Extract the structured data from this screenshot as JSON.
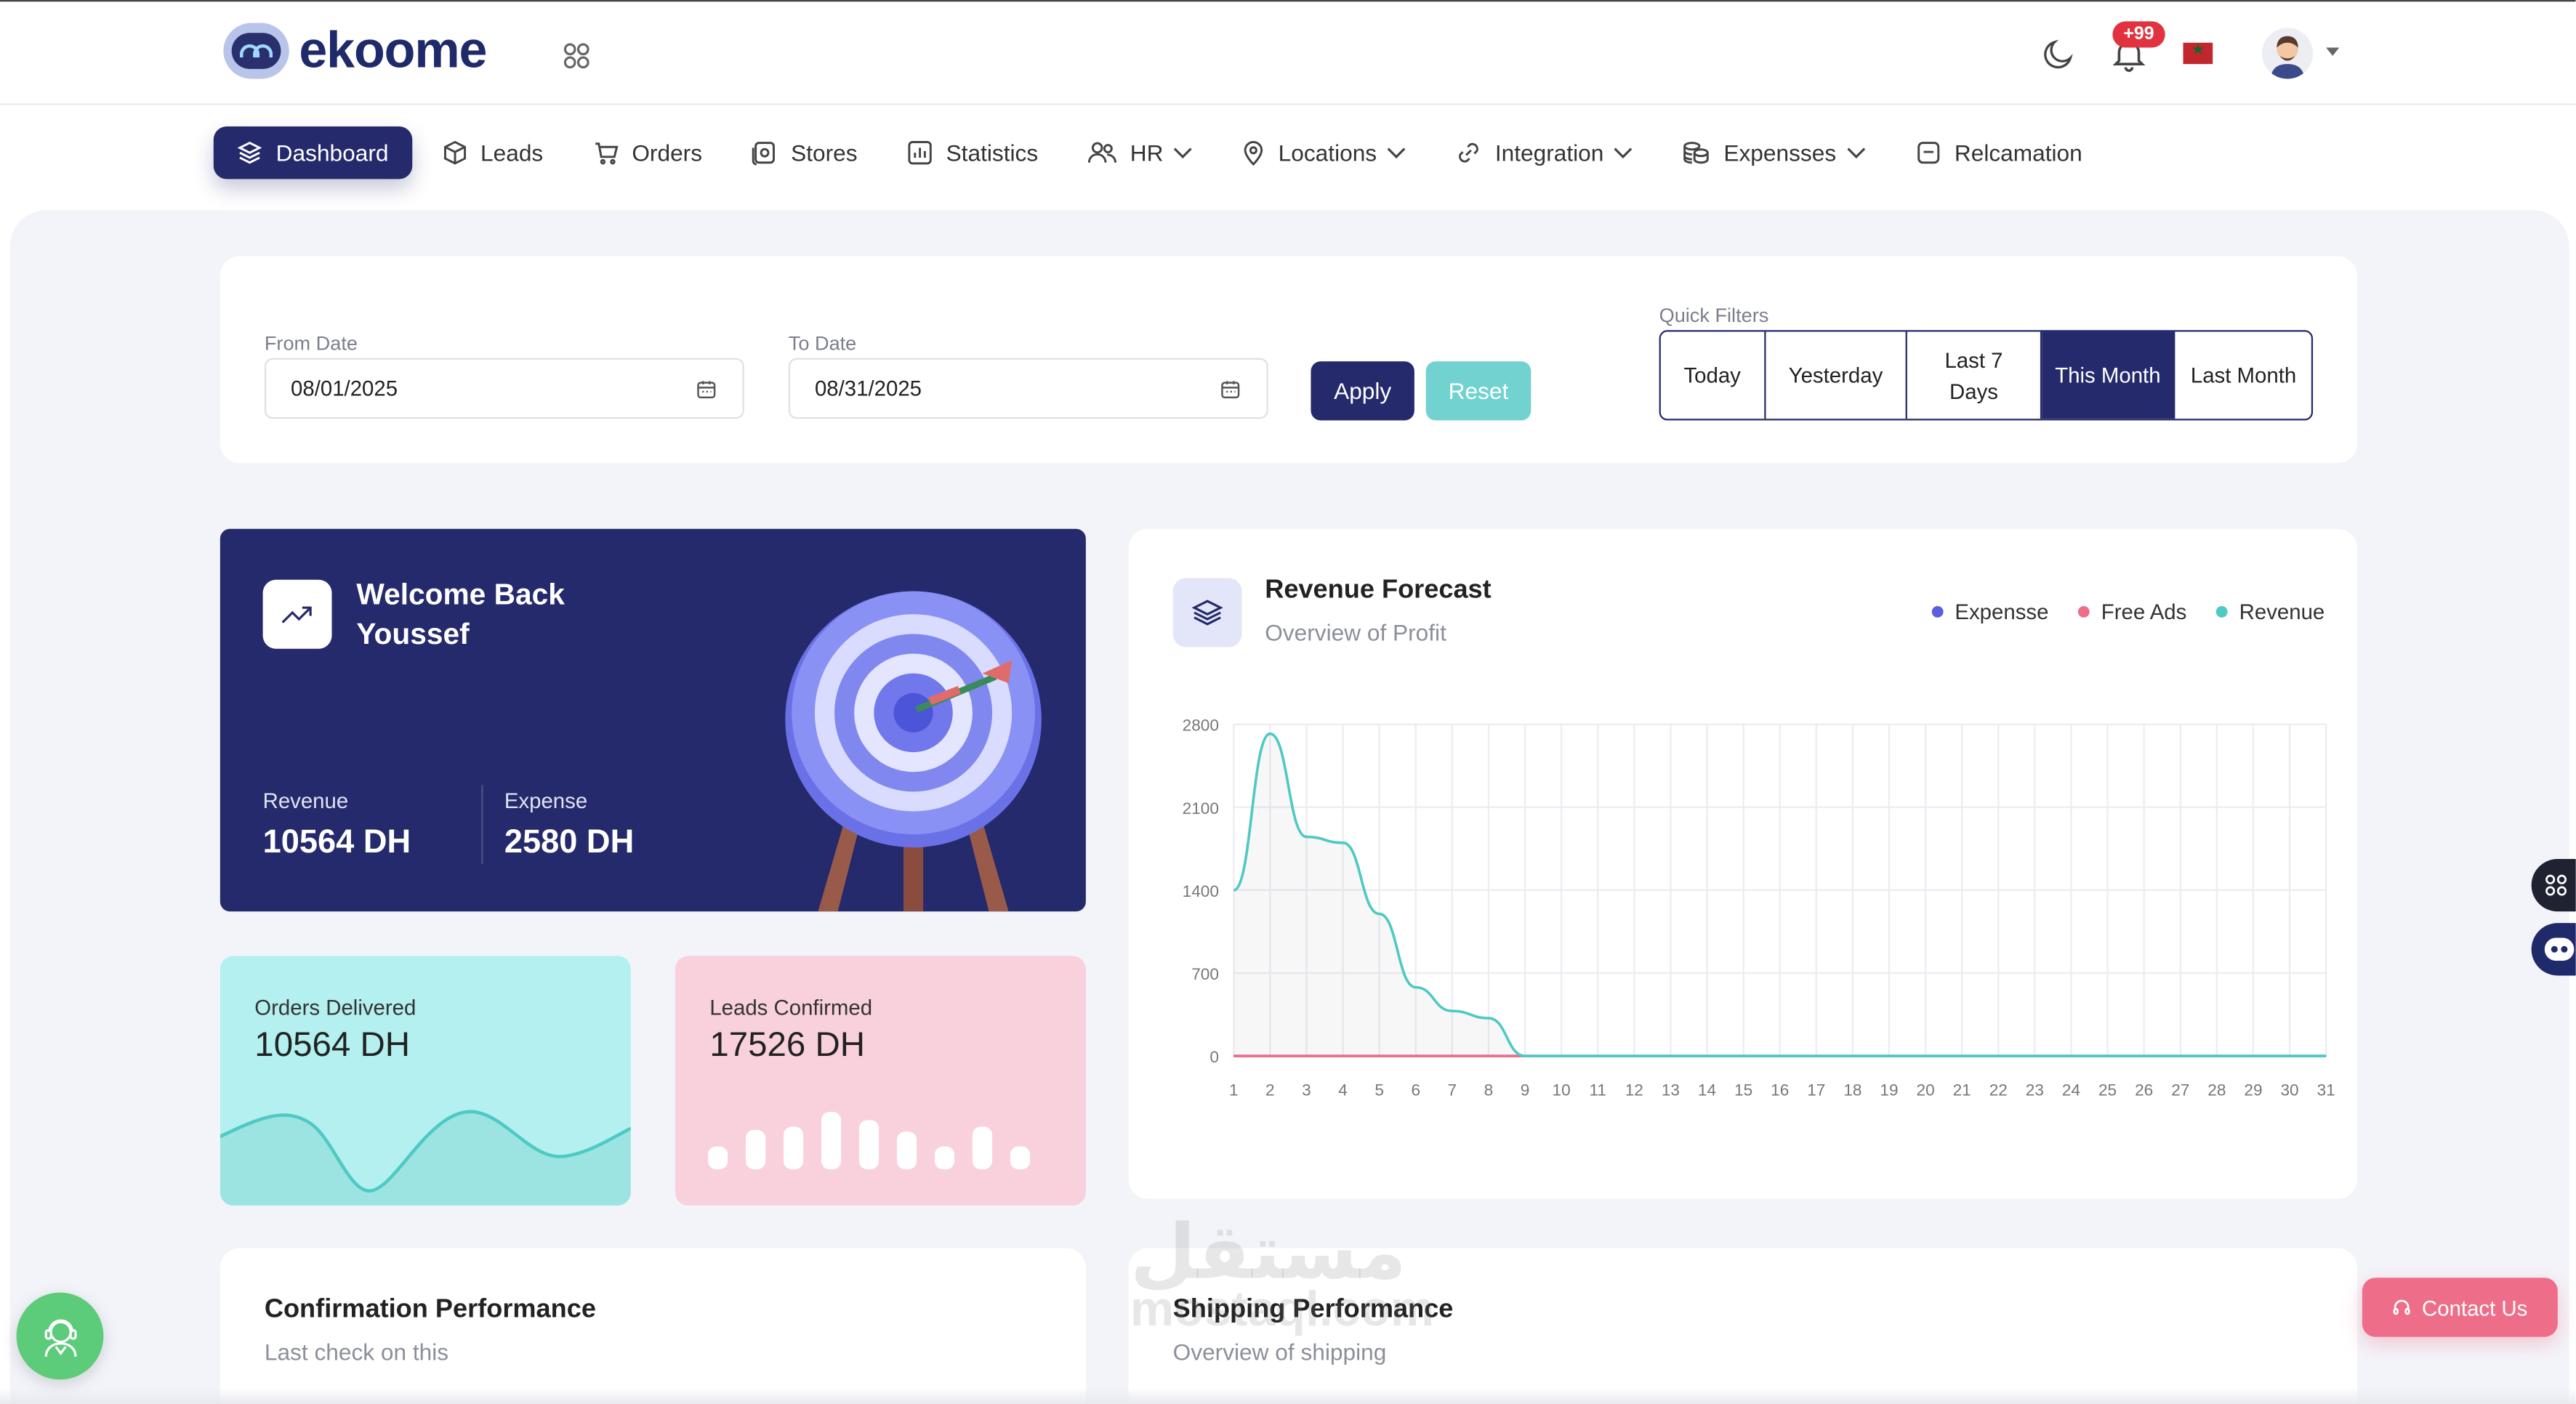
{
  "brand": {
    "name": "ekoome"
  },
  "header": {
    "notification_count": "+99"
  },
  "nav": {
    "items": [
      {
        "label": "Dashboard",
        "icon": "layers-icon",
        "active": true
      },
      {
        "label": "Leads",
        "icon": "cube-icon"
      },
      {
        "label": "Orders",
        "icon": "cart-icon"
      },
      {
        "label": "Stores",
        "icon": "store-icon"
      },
      {
        "label": "Statistics",
        "icon": "bar-chart-icon"
      },
      {
        "label": "HR",
        "icon": "users-icon",
        "dropdown": true
      },
      {
        "label": "Locations",
        "icon": "location-pin-icon",
        "dropdown": true
      },
      {
        "label": "Integration",
        "icon": "link-icon",
        "dropdown": true
      },
      {
        "label": "Expensses",
        "icon": "coins-icon",
        "dropdown": true
      },
      {
        "label": "Relcamation",
        "icon": "note-icon"
      }
    ]
  },
  "filters": {
    "from_label": "From Date",
    "from_value": "08/01/2025",
    "to_label": "To Date",
    "to_value": "08/31/2025",
    "apply_label": "Apply",
    "reset_label": "Reset",
    "quick_label": "Quick Filters",
    "quick": [
      {
        "label": "Today"
      },
      {
        "label": "Yesterday"
      },
      {
        "label": "Last 7 Days"
      },
      {
        "label": "This Month",
        "active": true
      },
      {
        "label": "Last Month"
      }
    ]
  },
  "welcome": {
    "title_line1": "Welcome Back",
    "title_line2": "Youssef",
    "revenue_label": "Revenue",
    "revenue_value": "10564 DH",
    "expense_label": "Expense",
    "expense_value": "2580 DH"
  },
  "orders_card": {
    "label": "Orders Delivered",
    "value": "10564 DH"
  },
  "leads_card": {
    "label": "Leads Confirmed",
    "value": "17526 DH"
  },
  "forecast": {
    "title": "Revenue Forecast",
    "subtitle": "Overview of Profit"
  },
  "confirmation": {
    "title": "Confirmation Performance",
    "subtitle": "Last check on this"
  },
  "shipping": {
    "title": "Shipping Performance",
    "subtitle": "Overview of shipping"
  },
  "watermark": {
    "line1": "مستقل",
    "line2": "mostaql.com"
  },
  "contact": {
    "label": "Contact Us"
  },
  "colors": {
    "primary": "#242a6b",
    "teal": "#71d2cf",
    "pink": "#ee6e8a",
    "expense": "#5a5fe0",
    "free_ads": "#ee6e8a",
    "revenue": "#4ec9c4"
  },
  "chart_data": {
    "type": "area",
    "title": "Revenue Forecast",
    "x": [
      1,
      2,
      3,
      4,
      5,
      6,
      7,
      8,
      9,
      10,
      11,
      12,
      13,
      14,
      15,
      16,
      17,
      18,
      19,
      20,
      21,
      22,
      23,
      24,
      25,
      26,
      27,
      28,
      29,
      30,
      31
    ],
    "ylim": [
      0,
      2800
    ],
    "yticks": [
      0,
      700,
      1400,
      2100,
      2800
    ],
    "grid": true,
    "legend_position": "top-right",
    "series": [
      {
        "name": "Expensse",
        "color": "#5a5fe0",
        "values": [
          0,
          0,
          0,
          0,
          0,
          0,
          0,
          0,
          0,
          0,
          0,
          0,
          0,
          0,
          0,
          0,
          0,
          0,
          0,
          0,
          0,
          0,
          0,
          0,
          0,
          0,
          0,
          0,
          0,
          0,
          0
        ]
      },
      {
        "name": "Free Ads",
        "color": "#ee6e8a",
        "values": [
          0,
          0,
          0,
          0,
          0,
          0,
          0,
          0,
          0,
          0,
          0,
          0,
          0,
          0,
          0,
          0,
          0,
          0,
          0,
          0,
          0,
          0,
          0,
          0,
          0,
          0,
          0,
          0,
          0,
          0,
          0
        ]
      },
      {
        "name": "Revenue",
        "color": "#4ec9c4",
        "values": [
          1400,
          2720,
          1850,
          1800,
          1200,
          580,
          380,
          320,
          0,
          0,
          0,
          0,
          0,
          0,
          0,
          0,
          0,
          0,
          0,
          0,
          0,
          0,
          0,
          0,
          0,
          0,
          0,
          0,
          0,
          0,
          0
        ]
      }
    ]
  }
}
